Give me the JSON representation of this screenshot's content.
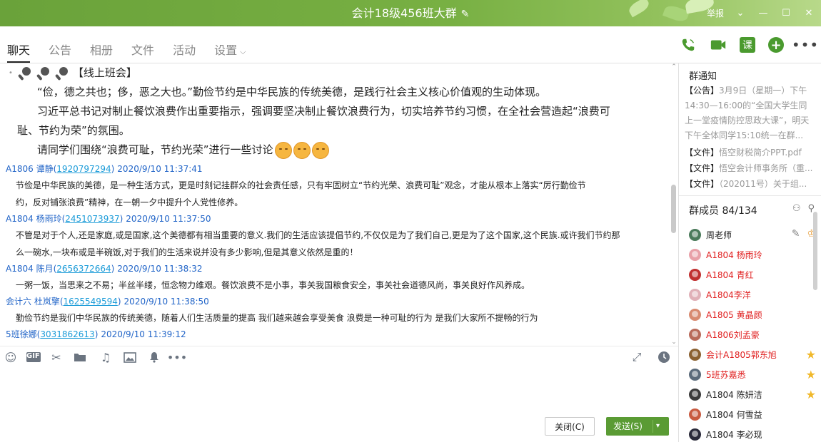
{
  "window": {
    "title": "会计18级456班大群",
    "report_label": "举报"
  },
  "tabs": [
    {
      "label": "聊天",
      "active": true
    },
    {
      "label": "公告"
    },
    {
      "label": "相册"
    },
    {
      "label": "文件"
    },
    {
      "label": "活动"
    },
    {
      "label": "设置"
    }
  ],
  "tab_actions": {
    "lesson_label": "课"
  },
  "announcement": {
    "head": "【线上班会】",
    "lines": [
      "“俭，德之共也；侈，恶之大也。”勤俭节约是中华民族的传统美德，是践行社会主义核心价值观的生动体现。",
      "习近平总书记对制止餐饮浪费作出重要指示，强调要坚决制止餐饮浪费行为，切实培养节约习惯，在全社会营造起“浪费可",
      "耻、节约为荣”的氛围。",
      "请同学们围绕“浪费可耻，节约光荣”进行一些讨论"
    ]
  },
  "messages": [
    {
      "name": "A1806  谭静(",
      "qq": "1920797294",
      "name_close": ")",
      "time": "2020/9/10 11:37:41",
      "lines": [
        "节俭是中华民族的美德，是一种生活方式，更是时刻记挂群众的社会责任感，只有牢固树立“节约光荣、浪费可耻”观念，才能从根本上落实“厉行勤俭节",
        "约，反对铺张浪费”精神，在一朝一夕中提升个人党性修养。"
      ]
    },
    {
      "name": "A1804    杨雨玲(",
      "qq": "2451073937",
      "name_close": ")",
      "time": "2020/9/10 11:37:50",
      "lines": [
        "不管是对于个人,还是家庭,或是国家,这个美德都有相当重要的意义.我们的生活应该提倡节约,不仅仅是为了我们自己,更是为了这个国家,这个民族.或许我们节约那",
        "么一碗水,一块布或是半碗饭,对于我们的生活来说并没有多少影响,但是其意义依然是重的！"
      ]
    },
    {
      "name": "A1804 陈月(",
      "qq": "2656372664",
      "name_close": ")",
      "time": "2020/9/10 11:38:32",
      "lines": [
        "一粥一饭，当思来之不易；半丝半缕，恒念物力维艰。餐饮浪费不是小事，事关我国粮食安全，事关社会道德风尚，事关良好作风养成。"
      ]
    },
    {
      "name": "会计六    杜岚擎(",
      "qq": "1625549594",
      "name_close": ")",
      "time": "2020/9/10 11:38:50",
      "lines": [
        "勤俭节约是我们中华民族的传统美德，随着人们生活质量的提高 我们越来越会享受美食    浪费是一种可耻的行为  是我们大家所不提畅的行为"
      ]
    },
    {
      "name": "5班徐娜(",
      "qq": "3031862613",
      "name_close": ")",
      "time": "2020/9/10 11:39:12",
      "lines": []
    }
  ],
  "buttons": {
    "close": "关闭(C)",
    "send": "发送(S)"
  },
  "group_notice": {
    "title": "群通知",
    "tag": "【公告】",
    "text": "3月9日（星期一）下午14:30—16:00的“全国大学生同上一堂疫情防控思政大课”，明天下午全体同学15:10统一在群..."
  },
  "files": [
    {
      "tag": "【文件】",
      "name": "悟空财税简介PPT.pdf"
    },
    {
      "tag": "【文件】",
      "name": "悟空会计师事务所（重..."
    },
    {
      "tag": "【文件】",
      "name": "（202011号）关于组..."
    }
  ],
  "members": {
    "title": "群成员 84/134",
    "list": [
      {
        "name": "周老师",
        "color": "#222222",
        "avatar": "#4a7a5a"
      },
      {
        "name": "A1804    杨雨玲",
        "color": "#e02020",
        "avatar": "#e8a0a8"
      },
      {
        "name": "A1804 青红",
        "color": "#e02020",
        "avatar": "#c03030"
      },
      {
        "name": "A1804李洋",
        "color": "#e02020",
        "avatar": "#e0b0b8"
      },
      {
        "name": "A1805 黄晶颜",
        "color": "#e02020",
        "avatar": "#d88a70"
      },
      {
        "name": "A1806刘孟豪",
        "color": "#e02020",
        "avatar": "#b86a5a"
      },
      {
        "name": "会计A1805郭东旭",
        "color": "#e02020",
        "avatar": "#8a6030",
        "star": true
      },
      {
        "name": "5班苏嘉悉",
        "color": "#e02020",
        "avatar": "#5a6a7a",
        "star": true
      },
      {
        "name": "A1804    陈妍洁",
        "color": "#222222",
        "avatar": "#3a3a3a",
        "star": true
      },
      {
        "name": "A1804  何雪益",
        "color": "#222222",
        "avatar": "#c85a40"
      },
      {
        "name": "A1804  李必现",
        "color": "#222222",
        "avatar": "#2a2a3a"
      }
    ]
  }
}
